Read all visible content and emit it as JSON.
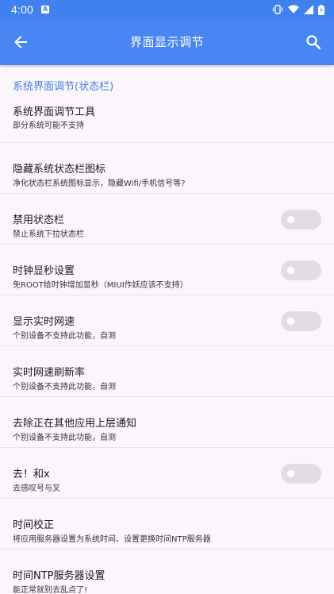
{
  "status_bar": {
    "time": "4:00",
    "notif_glyph": "A"
  },
  "app_bar": {
    "title": "界面显示调节"
  },
  "section": {
    "title": "系统界面调节(状态栏)"
  },
  "items": [
    {
      "title": "系统界面调节工具",
      "subtitle": "部分系统可能不支持",
      "has_toggle": false
    },
    {
      "title": "隐藏系统状态栏图标",
      "subtitle": "净化状态栏系统图标显示，隐藏Wifi/手机信号等?",
      "has_toggle": false
    },
    {
      "title": "禁用状态栏",
      "subtitle": "禁止系统下拉状态栏",
      "has_toggle": true,
      "toggle_on": false
    },
    {
      "title": "时钟显秒设置",
      "subtitle": "免ROOT给时钟增加显秒（MIUI作妖应该不支持）",
      "has_toggle": true,
      "toggle_on": false
    },
    {
      "title": "显示实时网速",
      "subtitle": "个别设备不支持此功能，自测",
      "has_toggle": true,
      "toggle_on": false
    },
    {
      "title": "实时网速刷新率",
      "subtitle": "个别设备不支持此功能，自测",
      "has_toggle": false
    },
    {
      "title": "去除正在其他应用上层通知",
      "subtitle": "个别设备不支持此功能，自测",
      "has_toggle": false
    },
    {
      "title": "去！和x",
      "subtitle": "去感叹号与叉",
      "has_toggle": true,
      "toggle_on": false
    },
    {
      "title": "时间校正",
      "subtitle": "将应用服务器设置为系统时间、设置更换时间NTP服务器",
      "has_toggle": false
    },
    {
      "title": "时间NTP服务器设置",
      "subtitle": "能正常就别去乱点了!",
      "has_toggle": false
    }
  ],
  "colors": {
    "status_bar": "#3F81EE",
    "app_bar": "#4886F3",
    "accent": "#4680E8",
    "background": "#FBF6FC",
    "toggle_off": "#E2DDE3"
  },
  "icons": {
    "back": "arrow-back-icon",
    "search": "search-icon"
  }
}
